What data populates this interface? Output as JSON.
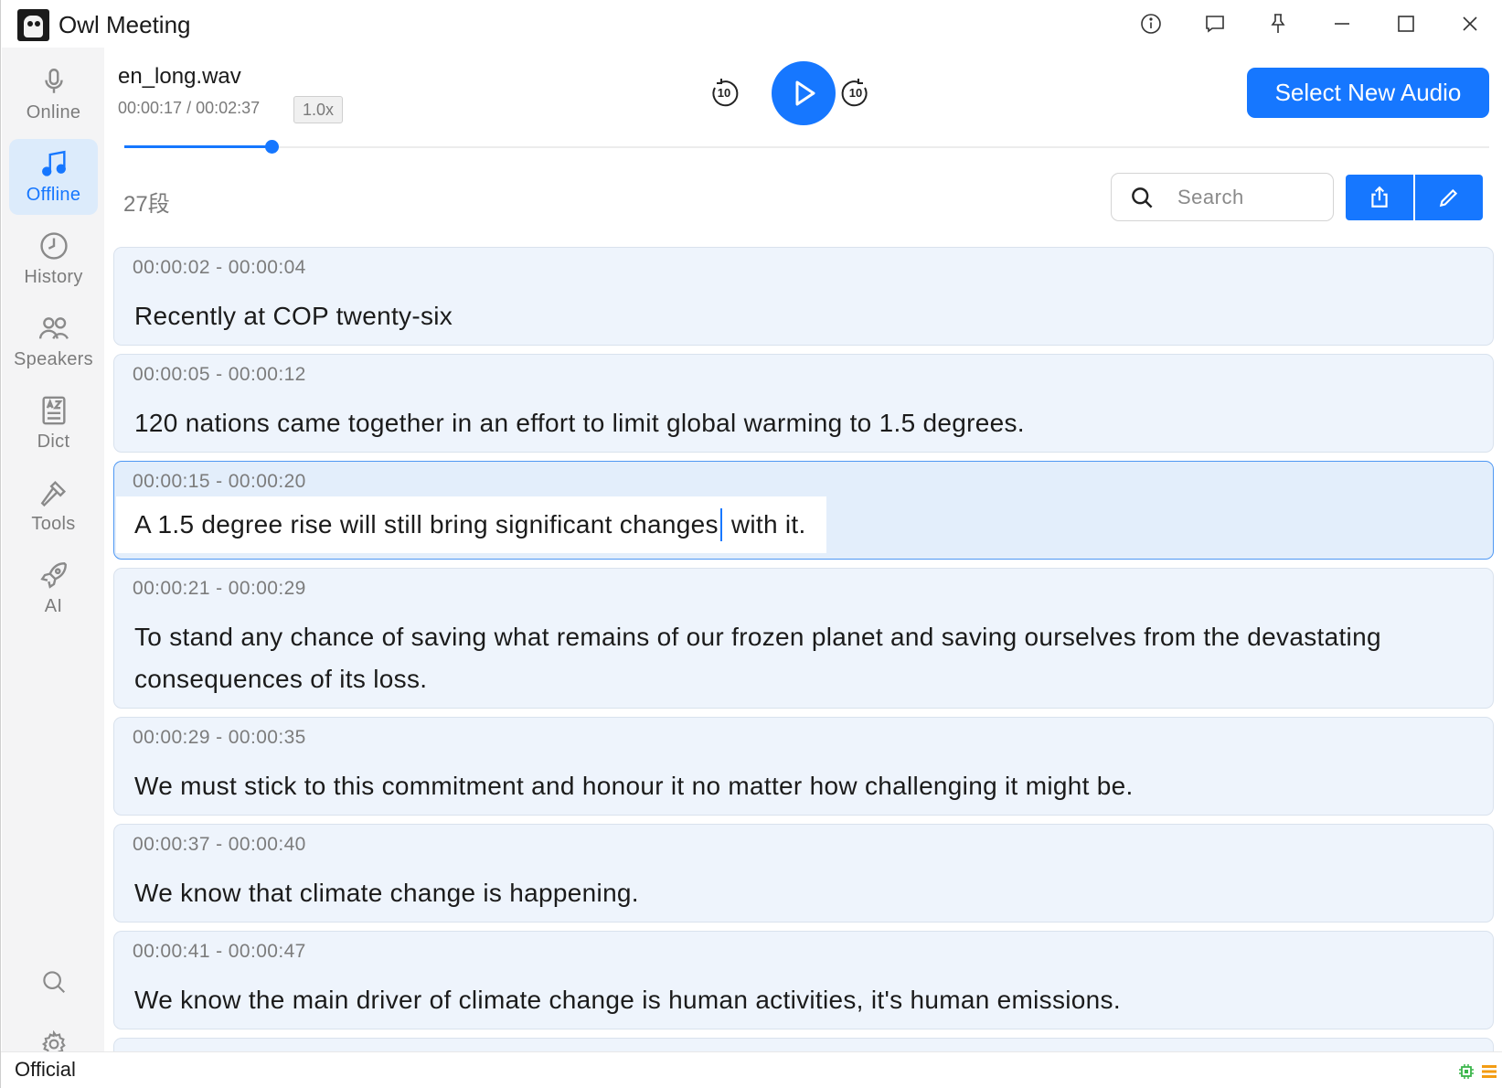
{
  "app": {
    "title": "Owl Meeting"
  },
  "titlebar": {
    "icons": [
      "info-icon",
      "feedback-icon",
      "pin-icon",
      "minimize-icon",
      "maximize-icon",
      "close-icon"
    ]
  },
  "sidebar": {
    "items": [
      {
        "label": "Online",
        "icon": "microphone-icon",
        "active": false
      },
      {
        "label": "Offline",
        "icon": "music-note-icon",
        "active": true
      },
      {
        "label": "History",
        "icon": "clock-icon",
        "active": false
      },
      {
        "label": "Speakers",
        "icon": "people-icon",
        "active": false
      },
      {
        "label": "Dict",
        "icon": "dictionary-icon",
        "active": false
      },
      {
        "label": "Tools",
        "icon": "hammer-icon",
        "active": false
      },
      {
        "label": "AI",
        "icon": "rocket-icon",
        "active": false
      }
    ],
    "bottom_icons": [
      "search-icon",
      "settings-icon"
    ]
  },
  "player": {
    "file_name": "en_long.wav",
    "current_time": "00:00:17",
    "total_time": "00:02:37",
    "time_display": "00:00:17 / 00:02:37",
    "speed": "1.0x",
    "rewind_seconds": "10",
    "forward_seconds": "10",
    "progress_fraction": 0.108,
    "select_audio_label": "Select New Audio"
  },
  "toolbar": {
    "segment_count": "27段",
    "search_placeholder": "Search"
  },
  "segments": [
    {
      "time": "00:00:02 - 00:00:04",
      "text": "Recently at COP twenty-six"
    },
    {
      "time": "00:00:05 - 00:00:12",
      "text": "120 nations came together in an effort to limit global warming to 1.5 degrees."
    },
    {
      "time": "00:00:15 - 00:00:20",
      "text_before_caret": "A 1.5 degree rise will still bring significant changes",
      "text_after_caret": " with it."
    },
    {
      "time": "00:00:21 - 00:00:29",
      "text": "To stand any chance of saving what remains of our frozen planet and saving ourselves from the devastating consequences of its loss."
    },
    {
      "time": "00:00:29 - 00:00:35",
      "text": "We must stick to this commitment and honour it no matter how challenging it might be."
    },
    {
      "time": "00:00:37 - 00:00:40",
      "text": "We know that climate change is happening."
    },
    {
      "time": "00:00:41 - 00:00:47",
      "text": "We know the main driver of climate change is human activities, it's human emissions."
    }
  ],
  "status": {
    "text": "Official",
    "colors": {
      "accent": "#1677ff",
      "chip": "#3ab54a",
      "list": "#f39c12"
    }
  }
}
